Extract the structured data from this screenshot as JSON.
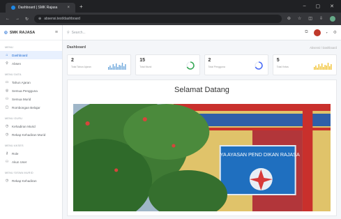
{
  "browser": {
    "tab_title": "Dashboard | SMK Rajasa",
    "url": "absensi.test/dashboard",
    "new_tab": "+",
    "tab_close": "×"
  },
  "sidebar": {
    "brand": "SMK RAJASA",
    "sections": [
      {
        "title": "MENU",
        "items": [
          {
            "label": "Dashboard",
            "icon": "home-icon",
            "glyph": "⌂",
            "active": true
          },
          {
            "label": "Absen",
            "icon": "pin-icon",
            "glyph": "⚲",
            "active": false
          }
        ]
      },
      {
        "title": "MENU DATA",
        "items": [
          {
            "label": "Tahun Ajaran",
            "icon": "calendar-icon",
            "glyph": "▭",
            "active": false
          },
          {
            "label": "Semua Pengguna",
            "icon": "users-icon",
            "glyph": "◎",
            "active": false
          },
          {
            "label": "Semua Murid",
            "icon": "student-icon",
            "glyph": "⚇",
            "active": false
          },
          {
            "label": "Rombongan Belajar",
            "icon": "class-icon",
            "glyph": "▢",
            "active": false
          }
        ]
      },
      {
        "title": "MENU GURU",
        "items": [
          {
            "label": "Kehadiran Murid",
            "icon": "clock-icon",
            "glyph": "◷",
            "active": false
          },
          {
            "label": "Rekap Kehadiran Murid",
            "icon": "report-icon",
            "glyph": "◷",
            "active": false
          }
        ]
      },
      {
        "title": "MENU AKSES",
        "items": [
          {
            "label": "Role",
            "icon": "key-icon",
            "glyph": "⚷",
            "active": false
          },
          {
            "label": "Akun User",
            "icon": "user-icon",
            "glyph": "⚇",
            "active": false
          }
        ]
      },
      {
        "title": "MENU SISWA MURID",
        "items": [
          {
            "label": "Rekap Kehadiran",
            "icon": "history-icon",
            "glyph": "◷",
            "active": false
          }
        ]
      }
    ]
  },
  "topbar": {
    "search_placeholder": "Search..."
  },
  "page": {
    "title": "Dashboard",
    "breadcrumb": "Absensi  /  Dashboard"
  },
  "cards": [
    {
      "value": "2",
      "label": "Total Tahun Ajaran",
      "viz": "bars"
    },
    {
      "value": "15",
      "label": "Total Murid",
      "viz": "ring"
    },
    {
      "value": "2",
      "label": "Total Pengguna",
      "viz": "ring"
    },
    {
      "value": "5",
      "label": "Total Kelas",
      "viz": "bars"
    }
  ],
  "welcome": {
    "heading": "Selamat Datang",
    "sign_text": "YA  AYASAN  PEND  DIKAN  RAJASA"
  },
  "colors": {
    "accent": "#1967d2",
    "bars_blue": "#6fa8dc",
    "bars_yellow": "#f1c232",
    "ring_green": "#34a853",
    "ring_blue": "#4a6cf7"
  }
}
